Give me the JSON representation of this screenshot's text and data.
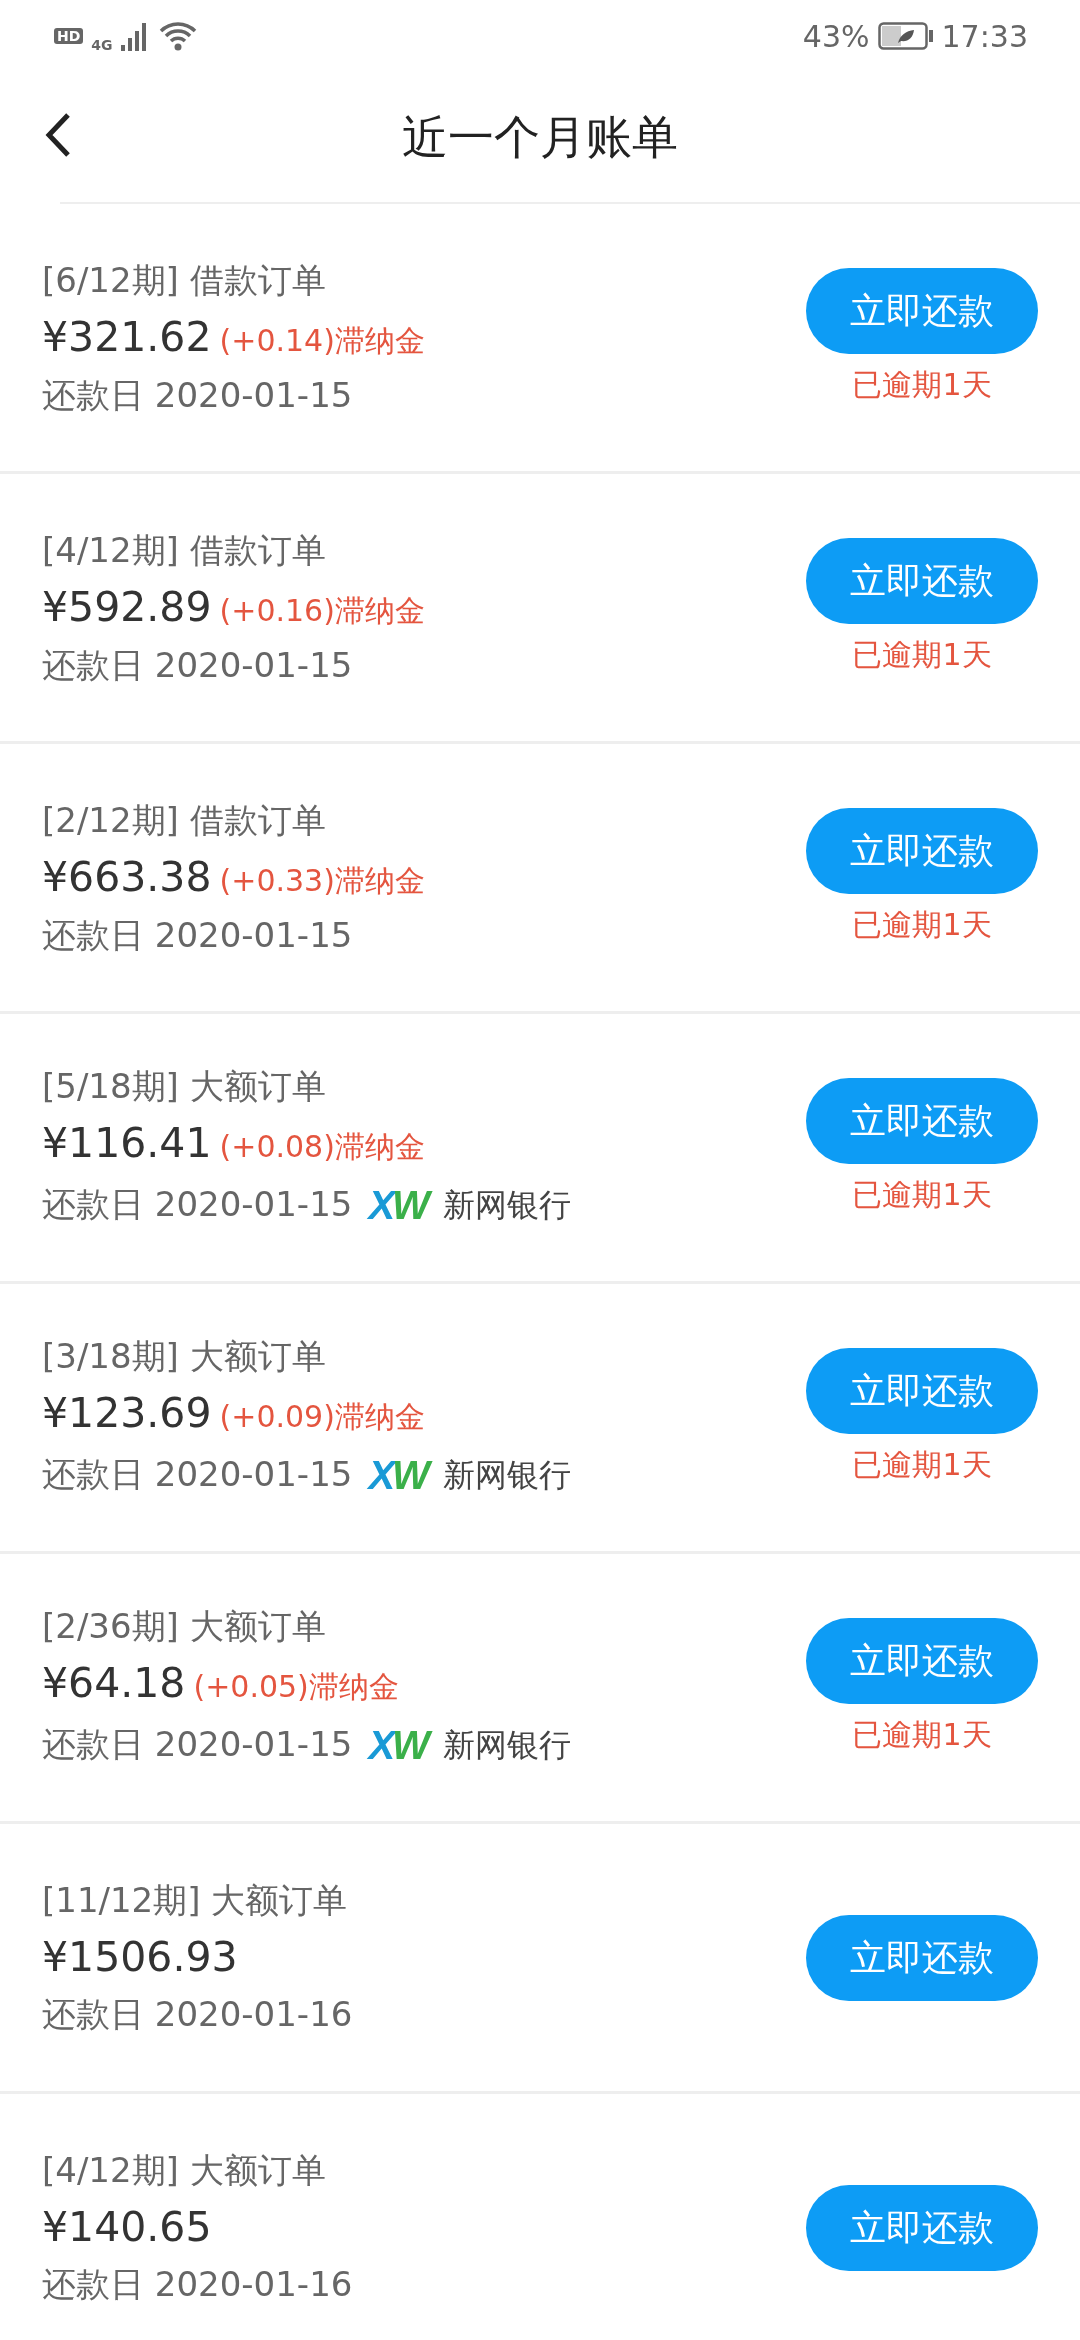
{
  "status_bar": {
    "hd_label": "HD",
    "network": "4G",
    "battery_text": "43%",
    "time": "17:33"
  },
  "header": {
    "title": "近一个月账单"
  },
  "bills": [
    {
      "period": "[6/12期] 借款订单",
      "amount": "¥321.62",
      "late_fee": "(+0.14)滞纳金",
      "due": "还款日 2020-01-15",
      "button": "立即还款",
      "overdue": "已逾期1天"
    },
    {
      "period": "[4/12期] 借款订单",
      "amount": "¥592.89",
      "late_fee": "(+0.16)滞纳金",
      "due": "还款日 2020-01-15",
      "button": "立即还款",
      "overdue": "已逾期1天"
    },
    {
      "period": "[2/12期] 借款订单",
      "amount": "¥663.38",
      "late_fee": "(+0.33)滞纳金",
      "due": "还款日 2020-01-15",
      "button": "立即还款",
      "overdue": "已逾期1天"
    },
    {
      "period": "[5/18期] 大额订单",
      "amount": "¥116.41",
      "late_fee": "(+0.08)滞纳金",
      "due": "还款日 2020-01-15",
      "bank": {
        "logo": "XW",
        "name": "新网银行"
      },
      "button": "立即还款",
      "overdue": "已逾期1天"
    },
    {
      "period": "[3/18期] 大额订单",
      "amount": "¥123.69",
      "late_fee": "(+0.09)滞纳金",
      "due": "还款日 2020-01-15",
      "bank": {
        "logo": "XW",
        "name": "新网银行"
      },
      "button": "立即还款",
      "overdue": "已逾期1天"
    },
    {
      "period": "[2/36期] 大额订单",
      "amount": "¥64.18",
      "late_fee": "(+0.05)滞纳金",
      "due": "还款日 2020-01-15",
      "bank": {
        "logo": "XW",
        "name": "新网银行"
      },
      "button": "立即还款",
      "overdue": "已逾期1天"
    },
    {
      "period": "[11/12期] 大额订单",
      "amount": "¥1506.93",
      "due": "还款日 2020-01-16",
      "button": "立即还款"
    },
    {
      "period": "[4/12期] 大额订单",
      "amount": "¥140.65",
      "due": "还款日 2020-01-16",
      "button": "立即还款"
    }
  ]
}
